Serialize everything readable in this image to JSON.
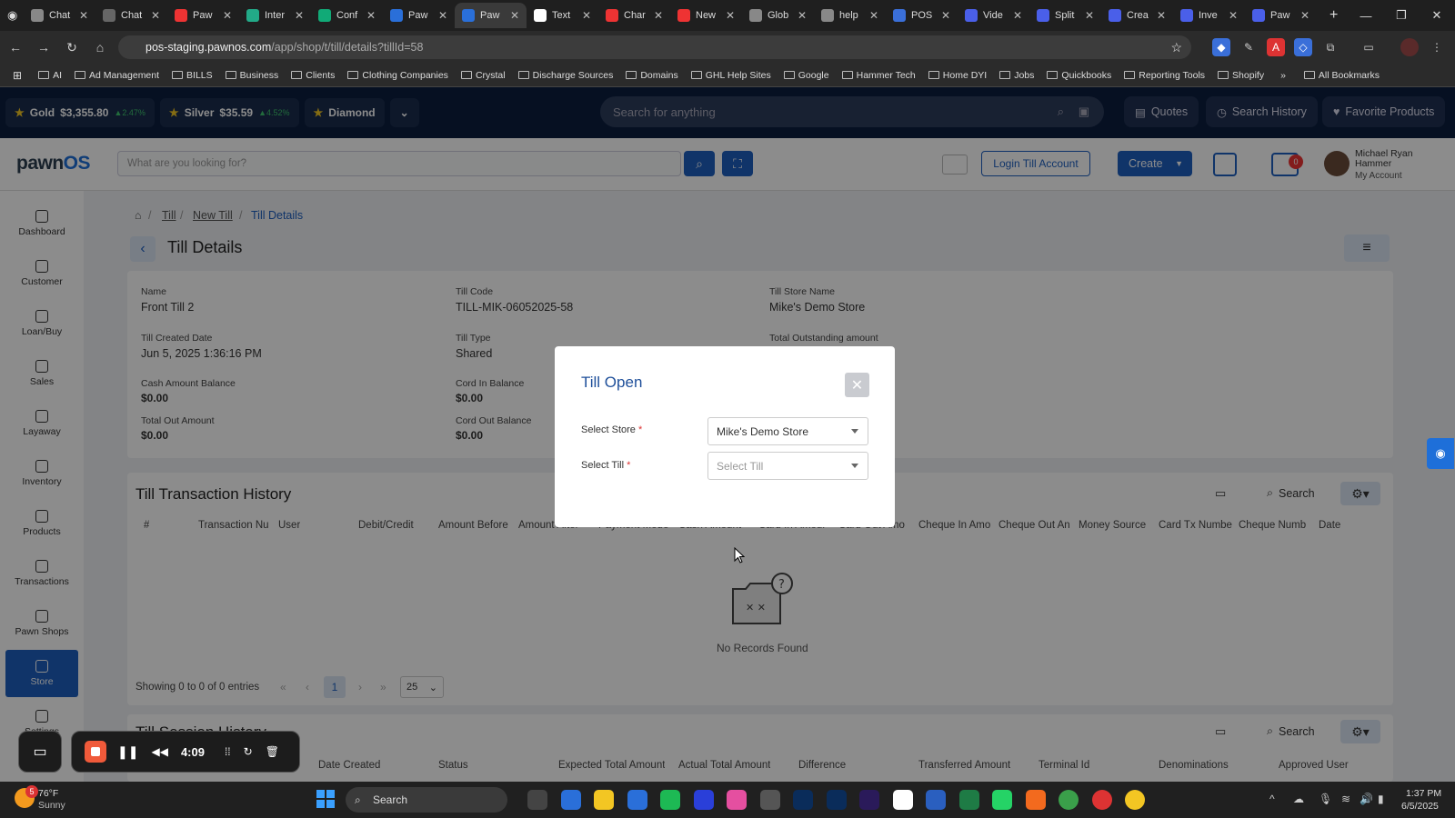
{
  "browser": {
    "tabs": [
      {
        "label": "Chat",
        "color": "#888"
      },
      {
        "label": "Chat",
        "color": "#666"
      },
      {
        "label": "Paw",
        "color": "#e33"
      },
      {
        "label": "Inter",
        "color": "#2a8"
      },
      {
        "label": "Conf",
        "color": "#1a7"
      },
      {
        "label": "Paw",
        "color": "#2a6fd9"
      },
      {
        "label": "Paw",
        "color": "#2a6fd9"
      },
      {
        "label": "Text",
        "color": "#fff"
      },
      {
        "label": "Char",
        "color": "#e33"
      },
      {
        "label": "New",
        "color": "#e33"
      },
      {
        "label": "Glob",
        "color": "#888"
      },
      {
        "label": "help",
        "color": "#888"
      },
      {
        "label": "POS",
        "color": "#3a6fd9"
      },
      {
        "label": "Vide",
        "color": "#4a5fe9"
      },
      {
        "label": "Split",
        "color": "#4a5fe9"
      },
      {
        "label": "Crea",
        "color": "#4a5fe9"
      },
      {
        "label": "Inve",
        "color": "#4a5fe9"
      },
      {
        "label": "Paw",
        "color": "#4a5fe9"
      }
    ],
    "active_tab": 6,
    "url_host": "pos-staging.pawnos.com",
    "url_path": "/app/shop/t/till/details?tillId=58",
    "bookmarks": [
      "AI",
      "Ad Management",
      "BILLS",
      "Business",
      "Clients",
      "Clothing Companies",
      "Crystal",
      "Discharge Sources",
      "Domains",
      "GHL Help Sites",
      "Google",
      "Hammer Tech",
      "Home DYI",
      "Jobs",
      "Quickbooks",
      "Reporting Tools",
      "Shopify"
    ],
    "all_bookmarks": "All Bookmarks"
  },
  "ticker": {
    "gold_label": "Gold",
    "gold_price": "$3,355.80",
    "gold_change": "▲2.47%",
    "silver_label": "Silver",
    "silver_price": "$35.59",
    "silver_change": "▲4.52%",
    "diamond_label": "Diamond",
    "search_placeholder": "Search for anything",
    "quotes": "Quotes",
    "search_history": "Search History",
    "favorite_products": "Favorite Products"
  },
  "header": {
    "logo_a": "pawn",
    "logo_b": "OS",
    "search_placeholder": "What are you looking for?",
    "login_till": "Login Till Account",
    "create": "Create",
    "notif_count": "0",
    "user_name": "Michael Ryan Hammer",
    "my_account": "My Account"
  },
  "sidebar": {
    "items": [
      "Dashboard",
      "Customer",
      "Loan/Buy",
      "Sales",
      "Layaway",
      "Inventory",
      "Products",
      "Transactions",
      "Pawn Shops",
      "Store",
      "Settings"
    ],
    "active": 9
  },
  "breadcrumb": [
    "Till",
    "New Till",
    "Till Details"
  ],
  "page_title": "Till Details",
  "details": {
    "name_label": "Name",
    "name": "Front Till 2",
    "code_label": "Till Code",
    "code": "TILL-MIK-06052025-58",
    "store_label": "Till Store Name",
    "store": "Mike's Demo Store",
    "created_label": "Till Created Date",
    "created": "Jun 5, 2025 1:36:16 PM",
    "type_label": "Till Type",
    "type": "Shared",
    "outstanding_label": "Total Outstanding amount",
    "cash_label": "Cash Amount Balance",
    "cash": "$0.00",
    "cardin_label": "Cord In Balance",
    "cardin": "$0.00",
    "totalout_label": "Total Out Amount",
    "totalout": "$0.00",
    "cardout_label": "Cord Out Balance",
    "cardout": "$0.00"
  },
  "history": {
    "title": "Till Transaction History",
    "search": "Search",
    "columns": [
      "#",
      "Transaction Nu",
      "User",
      "Debit/Credit",
      "Amount Before",
      "Amount After",
      "Payment Mode",
      "Cash Amount",
      "Card In Amour",
      "Card Out Amo",
      "Cheque In Amo",
      "Cheque Out An",
      "Money Source",
      "Card Tx Numbe",
      "Cheque Numb",
      "Date"
    ],
    "empty": "No Records Found",
    "showing": "Showing 0 to 0 of 0 entries",
    "page": "1",
    "page_size": "25"
  },
  "session": {
    "title": "Till Session History",
    "search": "Search",
    "columns": [
      "Date Created",
      "Status",
      "Expected Total Amount",
      "Actual Total Amount",
      "Difference",
      "Transferred Amount",
      "Terminal Id",
      "Denominations",
      "Approved User"
    ]
  },
  "modal": {
    "title": "Till Open",
    "store_label": "Select Store",
    "store_value": "Mike's Demo Store",
    "till_label": "Select Till",
    "till_placeholder": "Select Till"
  },
  "recorder": {
    "time": "4:09"
  },
  "taskbar": {
    "weather_temp": "76°F",
    "weather_cond": "Sunny",
    "weather_badge": "5",
    "search": "Search",
    "time": "1:37 PM",
    "date": "6/5/2025"
  }
}
